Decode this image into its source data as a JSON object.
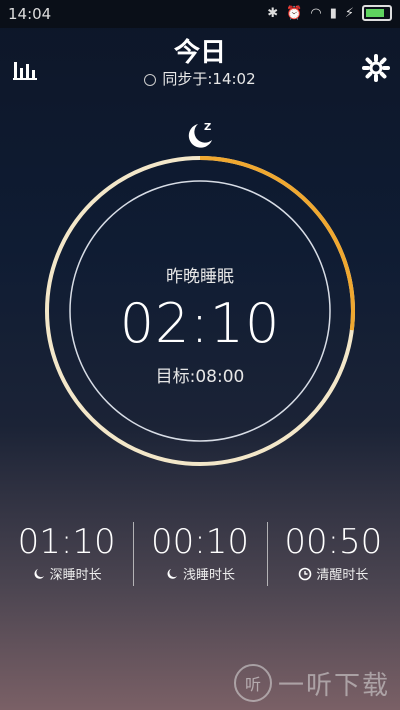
{
  "status_bar": {
    "time": "14:04"
  },
  "header": {
    "title": "今日",
    "sync_text": "同步于:14:02"
  },
  "sleep": {
    "label": "昨晚睡眠",
    "total": "02:10",
    "goal": "目标:08:00",
    "progress_fraction": 0.27
  },
  "stats": [
    {
      "value": "01:10",
      "label": "深睡时长",
      "icon": "moon-z-icon"
    },
    {
      "value": "00:10",
      "label": "浅睡时长",
      "icon": "moon-z-icon"
    },
    {
      "value": "00:50",
      "label": "清醒时长",
      "icon": "clock-icon"
    }
  ],
  "watermark": {
    "text": "一听下载",
    "logo": "听"
  },
  "colors": {
    "accent": "#f0a830",
    "ring": "#f3e7c9"
  }
}
